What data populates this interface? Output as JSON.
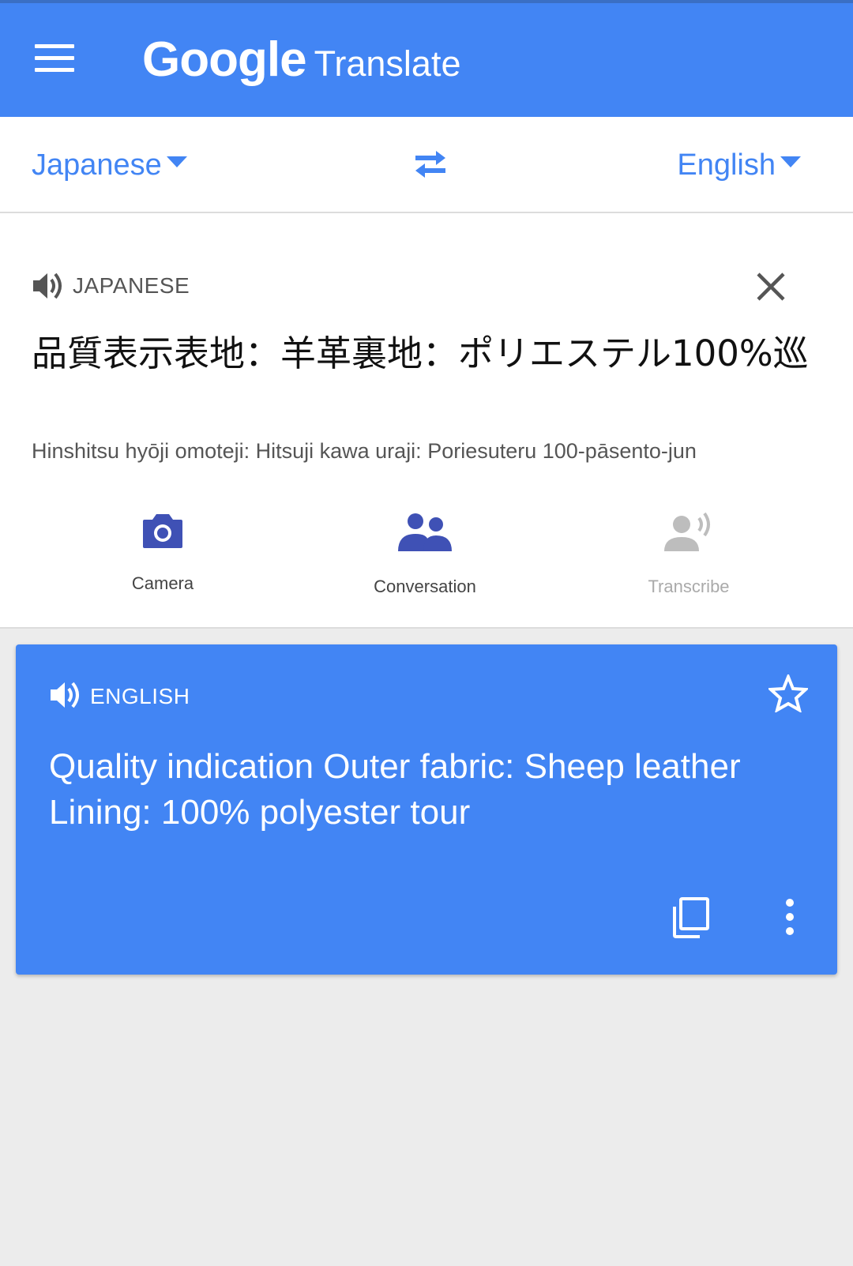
{
  "app_bar": {
    "brand_google": "Google",
    "brand_translate": "Translate",
    "menu_icon": "hamburger-menu-icon",
    "color": "#4285f4"
  },
  "language_bar": {
    "source_language": "Japanese",
    "target_language": "English",
    "swap_icon": "swap-arrows-icon"
  },
  "source": {
    "language_label": "JAPANESE",
    "text": "品質表示表地：羊革裏地：ポリエステル100%巡",
    "romanization": "Hinshitsu hyōji omoteji: Hitsuji kawa uraji: Poriesuteru 100-pāsento-jun",
    "speaker_icon": "speaker-icon",
    "clear_icon": "close-icon"
  },
  "actions": [
    {
      "label": "Camera",
      "icon": "camera-icon",
      "enabled": true
    },
    {
      "label": "Conversation",
      "icon": "people-icon",
      "enabled": true
    },
    {
      "label": "Transcribe",
      "icon": "transcribe-icon",
      "enabled": false
    }
  ],
  "result": {
    "language_label": "ENGLISH",
    "text": "Quality indication Outer fabric: Sheep leather Lining: 100% polyester tour",
    "star_icon": "star-outline-icon",
    "copy_icon": "copy-icon",
    "more_icon": "more-vert-icon"
  },
  "colors": {
    "accent": "#4285f4",
    "action_icon": "#3f51b5",
    "disabled": "#bdbdbd",
    "background": "#ececec"
  }
}
